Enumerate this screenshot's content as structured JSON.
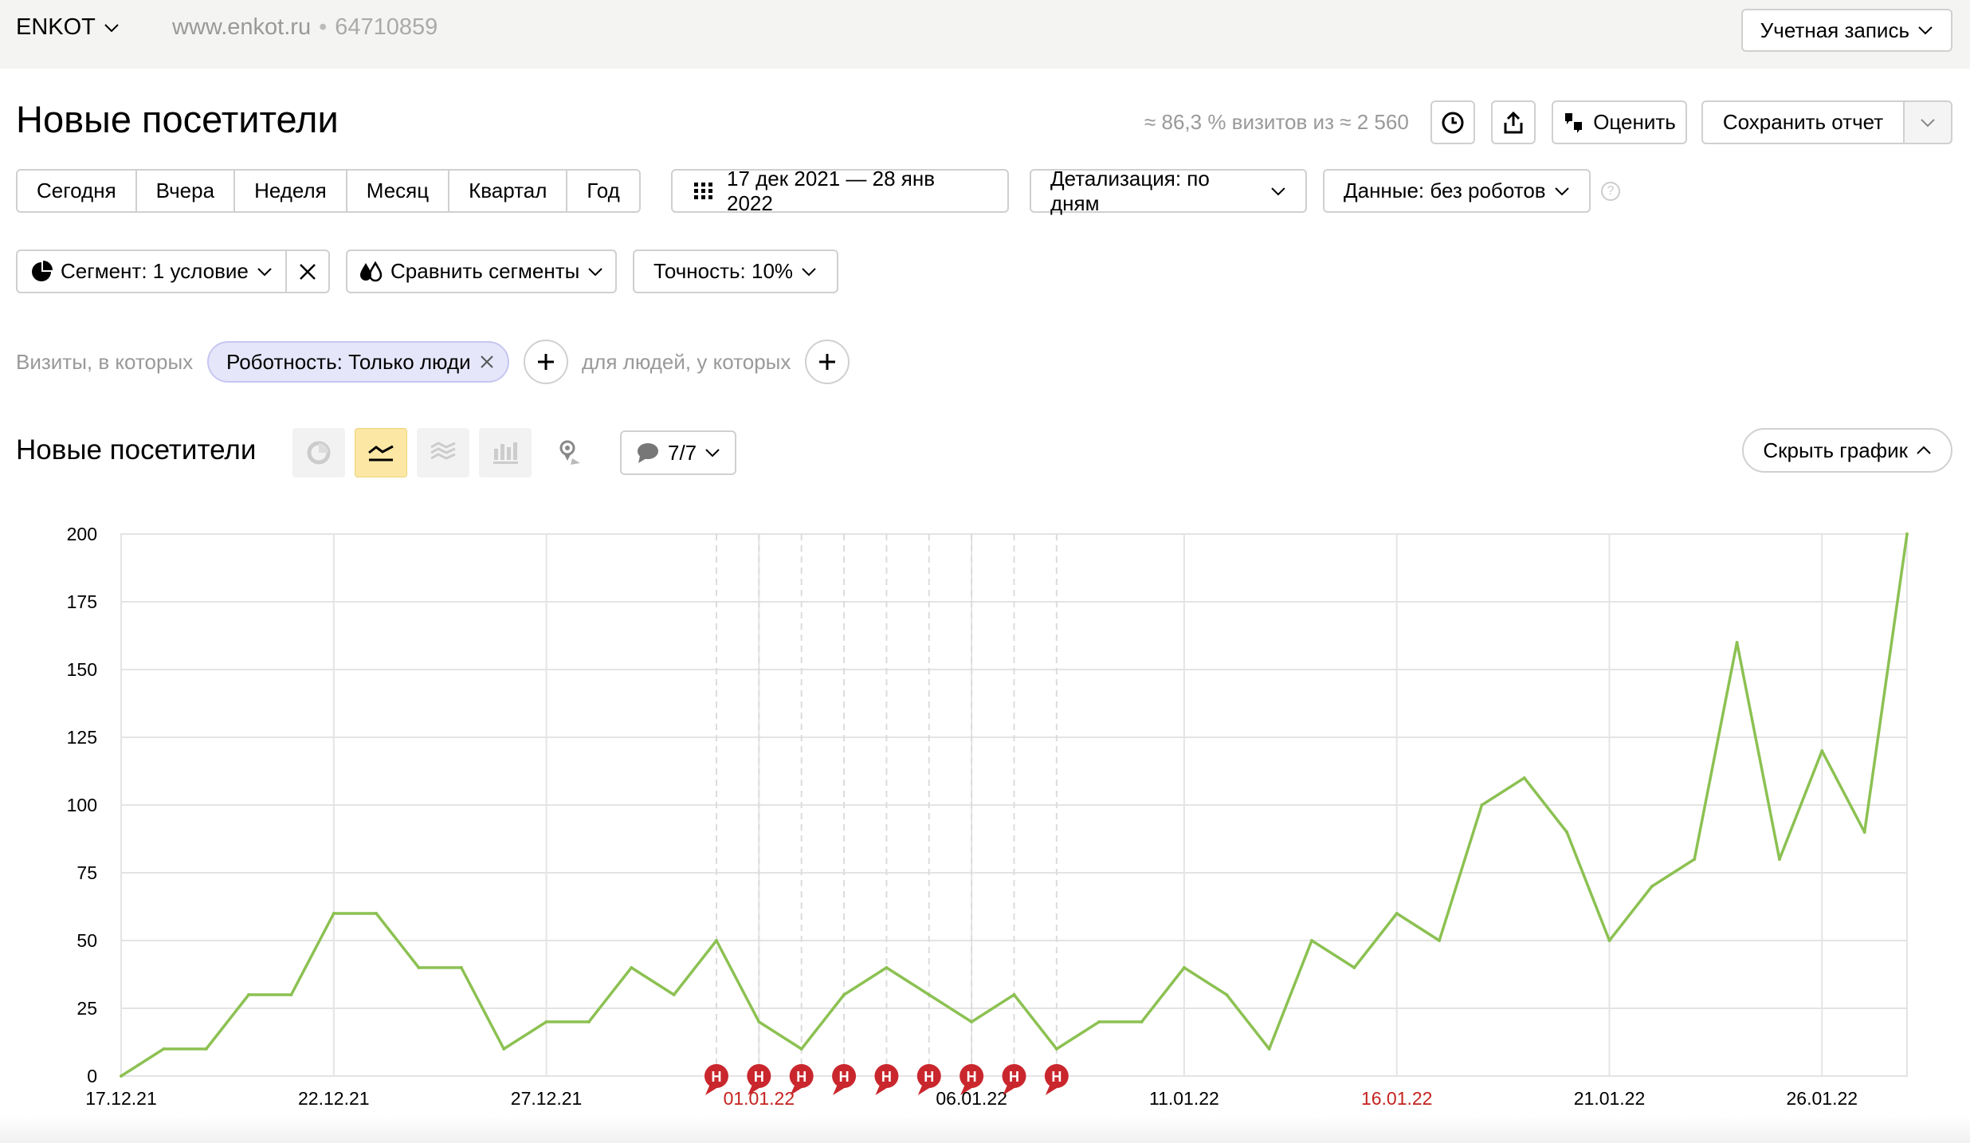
{
  "topbar": {
    "site_name": "ENKOT",
    "site_url": "www.enkot.ru",
    "separator": "•",
    "counter_id": "64710859",
    "account_label": "Учетная запись"
  },
  "header": {
    "title": "Новые посетители",
    "visits_info": "≈ 86,3 % визитов из ≈ 2 560",
    "rate_label": "Оценить",
    "save_label": "Сохранить отчет"
  },
  "period": {
    "presets": [
      "Сегодня",
      "Вчера",
      "Неделя",
      "Месяц",
      "Квартал",
      "Год"
    ],
    "date_range": "17 дек 2021 — 28 янв 2022",
    "detail": "Детализация: по дням",
    "data_filter": "Данные: без роботов",
    "help": "?"
  },
  "segment": {
    "label": "Сегмент: 1 условие",
    "compare": "Сравнить сегменты",
    "accuracy": "Точность: 10%"
  },
  "filters": {
    "visits_label": "Визиты, в которых",
    "chip": "Роботность: Только люди",
    "people_label": "для людей, у которых"
  },
  "chart_header": {
    "title": "Новые посетители",
    "notes": "7/7",
    "hide_chart": "Скрыть график"
  },
  "colors": {
    "line": "#8cc152",
    "holiday_text": "#c4221f",
    "holiday_marker": "#c9272d",
    "active_chart_type": "#fce7a4"
  },
  "chart_data": {
    "type": "line",
    "title": "",
    "xlabel": "",
    "ylabel": "",
    "ylim": [
      0,
      200
    ],
    "yticks": [
      0,
      25,
      50,
      75,
      100,
      125,
      150,
      175,
      200
    ],
    "x": [
      "17.12.21",
      "18.12.21",
      "19.12.21",
      "20.12.21",
      "21.12.21",
      "22.12.21",
      "23.12.21",
      "24.12.21",
      "25.12.21",
      "26.12.21",
      "27.12.21",
      "28.12.21",
      "29.12.21",
      "30.12.21",
      "31.12.21",
      "01.01.22",
      "02.01.22",
      "03.01.22",
      "04.01.22",
      "05.01.22",
      "06.01.22",
      "07.01.22",
      "08.01.22",
      "09.01.22",
      "10.01.22",
      "11.01.22",
      "12.01.22",
      "13.01.22",
      "14.01.22",
      "15.01.22",
      "16.01.22",
      "17.01.22",
      "18.01.22",
      "19.01.22",
      "20.01.22",
      "21.01.22",
      "22.01.22",
      "23.01.22",
      "24.01.22",
      "25.01.22",
      "26.01.22",
      "27.01.22",
      "28.01.22"
    ],
    "xtick_labels": [
      {
        "label": "17.12.21",
        "index": 0,
        "holiday": false
      },
      {
        "label": "22.12.21",
        "index": 5,
        "holiday": false
      },
      {
        "label": "27.12.21",
        "index": 10,
        "holiday": false
      },
      {
        "label": "01.01.22",
        "index": 15,
        "holiday": true
      },
      {
        "label": "06.01.22",
        "index": 20,
        "holiday": false
      },
      {
        "label": "11.01.22",
        "index": 25,
        "holiday": false
      },
      {
        "label": "16.01.22",
        "index": 30,
        "holiday": true
      },
      {
        "label": "21.01.22",
        "index": 35,
        "holiday": false
      },
      {
        "label": "26.01.22",
        "index": 40,
        "holiday": false
      }
    ],
    "series": [
      {
        "values": [
          0,
          10,
          10,
          30,
          30,
          60,
          60,
          40,
          40,
          10,
          20,
          20,
          40,
          30,
          50,
          20,
          10,
          30,
          40,
          30,
          20,
          30,
          10,
          20,
          20,
          40,
          30,
          10,
          50,
          40,
          60,
          50,
          100,
          110,
          90,
          50,
          70,
          80,
          160,
          80,
          120,
          90,
          200
        ]
      }
    ],
    "holiday_marker_label": "Н",
    "holiday_indices": [
      14,
      15,
      16,
      17,
      18,
      19,
      20,
      21,
      22
    ],
    "grid": true
  }
}
